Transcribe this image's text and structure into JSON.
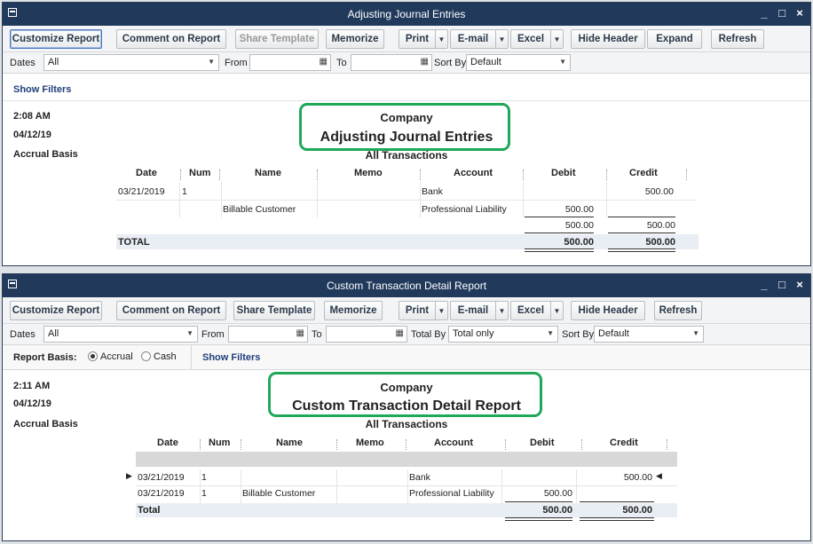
{
  "window1": {
    "title": "Adjusting Journal Entries",
    "toolbar": {
      "customize": "Customize Report",
      "comment": "Comment on Report",
      "share": "Share Template",
      "memorize": "Memorize",
      "print": "Print",
      "email": "E-mail",
      "excel": "Excel",
      "hide_header": "Hide Header",
      "expand": "Expand",
      "refresh": "Refresh"
    },
    "filters": {
      "dates_label": "Dates",
      "dates_value": "All",
      "from_label": "From",
      "from_value": "",
      "to_label": "To",
      "to_value": "",
      "sortby_label": "Sort By",
      "sortby_value": "Default"
    },
    "show_filters": "Show Filters",
    "report": {
      "time": "2:08 AM",
      "date": "04/12/19",
      "basis": "Accrual Basis",
      "company": "Company",
      "title": "Adjusting Journal Entries",
      "subtitle": "All Transactions",
      "columns": [
        "Date",
        "Num",
        "Name",
        "Memo",
        "Account",
        "Debit",
        "Credit"
      ],
      "rows": [
        {
          "date": "03/21/2019",
          "num": "1",
          "name": "",
          "memo": "",
          "account": "Bank",
          "debit": "",
          "credit": "500.00"
        },
        {
          "date": "",
          "num": "",
          "name": "Billable Customer",
          "memo": "",
          "account": "Professional Liability",
          "debit": "500.00",
          "credit": ""
        }
      ],
      "subtotal": {
        "debit": "500.00",
        "credit": "500.00"
      },
      "total": {
        "label": "TOTAL",
        "debit": "500.00",
        "credit": "500.00"
      }
    }
  },
  "window2": {
    "title": "Custom Transaction Detail Report",
    "toolbar": {
      "customize": "Customize Report",
      "comment": "Comment on Report",
      "share": "Share Template",
      "memorize": "Memorize",
      "print": "Print",
      "email": "E-mail",
      "excel": "Excel",
      "hide_header": "Hide Header",
      "refresh": "Refresh"
    },
    "filters": {
      "dates_label": "Dates",
      "dates_value": "All",
      "from_label": "From",
      "from_value": "",
      "to_label": "To",
      "to_value": "",
      "totalby_label": "Total By",
      "totalby_value": "Total only",
      "sortby_label": "Sort By",
      "sortby_value": "Default"
    },
    "basis": {
      "label": "Report Basis:",
      "accrual": "Accrual",
      "cash": "Cash",
      "selected": "Accrual"
    },
    "show_filters": "Show Filters",
    "report": {
      "time": "2:11 AM",
      "date": "04/12/19",
      "basis": "Accrual Basis",
      "company": "Company",
      "title": "Custom Transaction Detail Report",
      "subtitle": "All Transactions",
      "columns": [
        "Date",
        "Num",
        "Name",
        "Memo",
        "Account",
        "Debit",
        "Credit"
      ],
      "rows": [
        {
          "date": "03/21/2019",
          "num": "1",
          "name": "",
          "memo": "",
          "account": "Bank",
          "debit": "",
          "credit": "500.00"
        },
        {
          "date": "03/21/2019",
          "num": "1",
          "name": "Billable Customer",
          "memo": "",
          "account": "Professional Liability",
          "debit": "500.00",
          "credit": ""
        }
      ],
      "total": {
        "label": "Total",
        "debit": "500.00",
        "credit": "500.00"
      }
    }
  },
  "colors": {
    "titlebar": "#213a5c",
    "highlight": "#1fa85a",
    "link": "#1f3f7a"
  }
}
